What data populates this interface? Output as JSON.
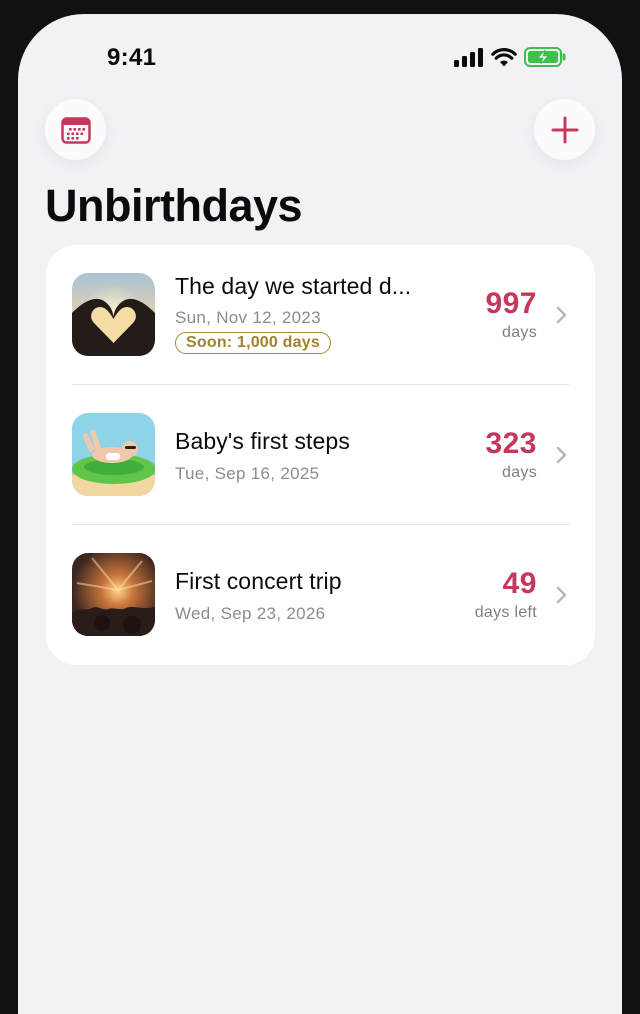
{
  "status_bar": {
    "time": "9:41"
  },
  "page": {
    "title": "Unbirthdays"
  },
  "colors": {
    "accent": "#c4385c",
    "badge": "#a08232",
    "background": "#f2f1f6"
  },
  "toolbar": {
    "left_icon": "calendar-icon",
    "right_icon": "plus-icon"
  },
  "unbirthdays": [
    {
      "title": "The day we started d...",
      "date": "Sun, Nov 12, 2023",
      "badge": "Soon: 1,000 days",
      "count": "997",
      "unit": "days",
      "thumbnail": "heart-hands-sunset-photo"
    },
    {
      "title": "Baby's first steps",
      "date": "Tue, Sep 16, 2025",
      "count": "323",
      "unit": "days",
      "thumbnail": "baby-pool-float-photo"
    },
    {
      "title": "First concert trip",
      "date": "Wed, Sep 23, 2026",
      "count": "49",
      "unit": "days left",
      "thumbnail": "concert-crowd-photo"
    }
  ]
}
